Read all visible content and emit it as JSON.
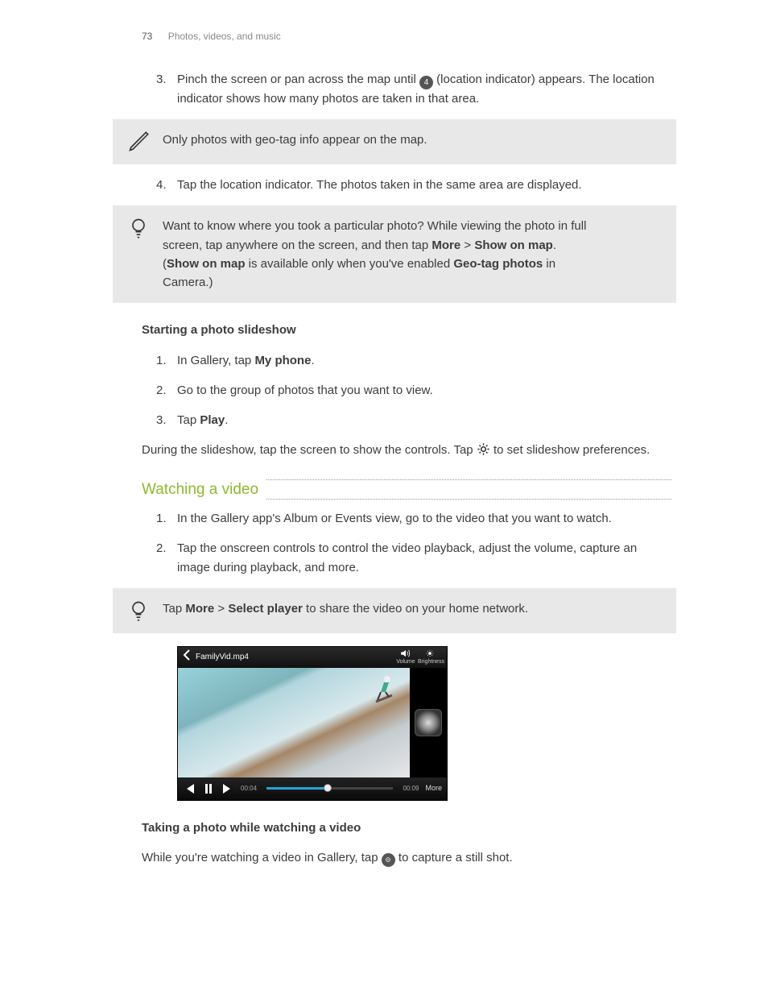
{
  "header": {
    "page_number": "73",
    "chapter": "Photos, videos, and music"
  },
  "steps_top": [
    {
      "num": "3.",
      "pre": "Pinch the screen or pan across the map until ",
      "dot": "4",
      "post": " (location indicator) appears. The location indicator shows how many photos are taken in that area."
    }
  ],
  "callout_pen": {
    "text": "Only photos with geo-tag info appear on the map."
  },
  "step4": {
    "num": "4.",
    "text": "Tap the location indicator. The photos taken in the same area are displayed."
  },
  "callout_tip1": {
    "pre": "Want to know where you took a particular photo? While viewing the photo in full screen, tap anywhere on the screen, and then tap ",
    "b1": "More",
    "gt": " > ",
    "b2": "Show on map",
    "mid": ". (",
    "b3": "Show on map",
    "mid2": " is available only when you've enabled ",
    "b4": "Geo-tag photos",
    "post": " in Camera.)"
  },
  "slideshow": {
    "heading": "Starting a photo slideshow",
    "items": [
      {
        "num": "1.",
        "pre": "In Gallery, tap ",
        "b": "My phone",
        "post": "."
      },
      {
        "num": "2.",
        "pre": "Go to the group of photos that you want to view.",
        "b": "",
        "post": ""
      },
      {
        "num": "3.",
        "pre": "Tap ",
        "b": "Play",
        "post": "."
      }
    ],
    "after_pre": "During the slideshow, tap the screen to show the controls. Tap ",
    "after_post": " to set slideshow preferences."
  },
  "watching": {
    "title": "Watching a video",
    "items": [
      {
        "num": "1.",
        "text": "In the Gallery app's Album or Events view, go to the video that you want to watch."
      },
      {
        "num": "2.",
        "text": "Tap the onscreen controls to control the video playback, adjust the volume, capture an image during playback, and more."
      }
    ]
  },
  "callout_tip2": {
    "pre": "Tap ",
    "b1": "More",
    "gt": " > ",
    "b2": "Select player",
    "post": " to share the video on your home network."
  },
  "player": {
    "filename": "FamilyVid.mp4",
    "volume_label": "Volume",
    "brightness_label": "Brightness",
    "time_current": "00:04",
    "time_total": "00:09",
    "more": "More"
  },
  "taking_photo": {
    "heading": "Taking a photo while watching a video",
    "pre": "While you're watching a video in Gallery, tap ",
    "post": " to capture a still shot."
  }
}
